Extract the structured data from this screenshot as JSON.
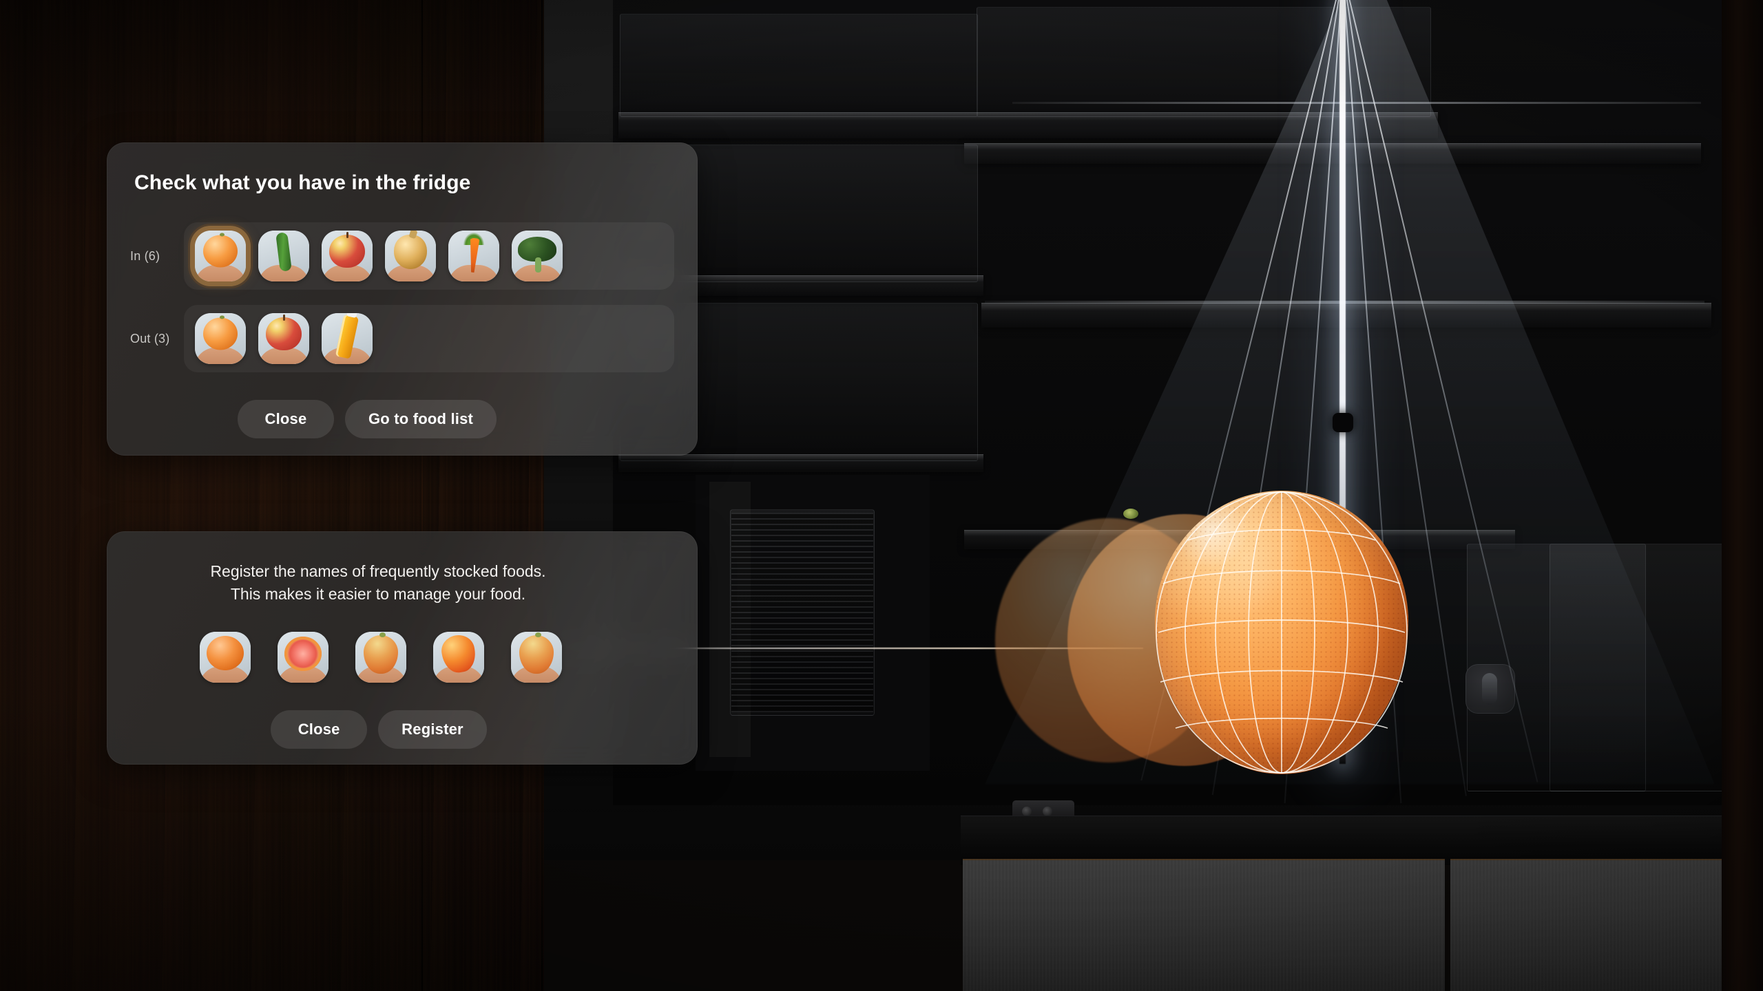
{
  "scene": {
    "description": "Smart refrigerator interior with overhead camera scan cone and 3D-scanned orange",
    "accent_selected": "#8f6a3e",
    "card_surface": "#2e2c2b",
    "button_surface": "#4a4744",
    "text_primary": "#ffffff",
    "text_secondary": "#c9c7c4",
    "scan_beam_color": "#ffeed6"
  },
  "inventory_card": {
    "title": "Check what you have in the fridge",
    "rows": [
      {
        "label": "In (6)",
        "items": [
          {
            "name": "orange",
            "selected": true
          },
          {
            "name": "cucumber",
            "selected": false
          },
          {
            "name": "apple",
            "selected": false
          },
          {
            "name": "onion",
            "selected": false
          },
          {
            "name": "carrot",
            "selected": false
          },
          {
            "name": "broccoli",
            "selected": false
          }
        ]
      },
      {
        "label": "Out (3)",
        "items": [
          {
            "name": "orange",
            "selected": false
          },
          {
            "name": "apple",
            "selected": false
          },
          {
            "name": "orange-juice-bottle",
            "selected": false
          }
        ]
      }
    ],
    "buttons": [
      {
        "label": "Close",
        "role": "secondary"
      },
      {
        "label": "Go to food list",
        "role": "primary"
      }
    ]
  },
  "register_card": {
    "line1": "Register the names of frequently stocked foods.",
    "line2": "This makes it easier to manage your food.",
    "items": [
      {
        "name": "orange"
      },
      {
        "name": "grapefruit-halved"
      },
      {
        "name": "grapefruit"
      },
      {
        "name": "mango"
      },
      {
        "name": "pomelo"
      }
    ],
    "buttons": [
      {
        "label": "Close",
        "role": "secondary"
      },
      {
        "label": "Register",
        "role": "primary"
      }
    ]
  }
}
